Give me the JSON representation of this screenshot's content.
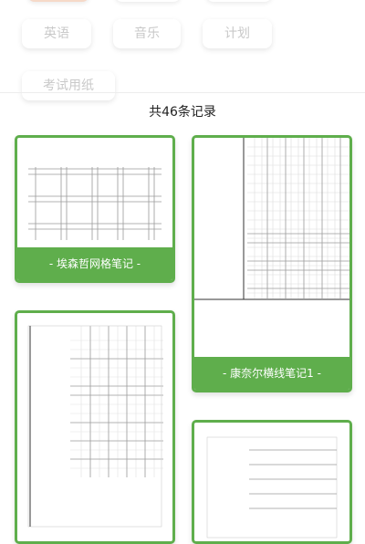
{
  "categories": [
    "英语",
    "音乐",
    "计划",
    "考试用纸"
  ],
  "record_count": "共46条记录",
  "colors": {
    "accent": "#5fae4c",
    "chip_text": "#c9c9c9"
  },
  "cards": [
    {
      "label": "- 埃森哲网格笔记 -"
    },
    {
      "label": "- 康奈尔横线笔记1 -"
    },
    {
      "label": ""
    },
    {
      "label": ""
    }
  ]
}
